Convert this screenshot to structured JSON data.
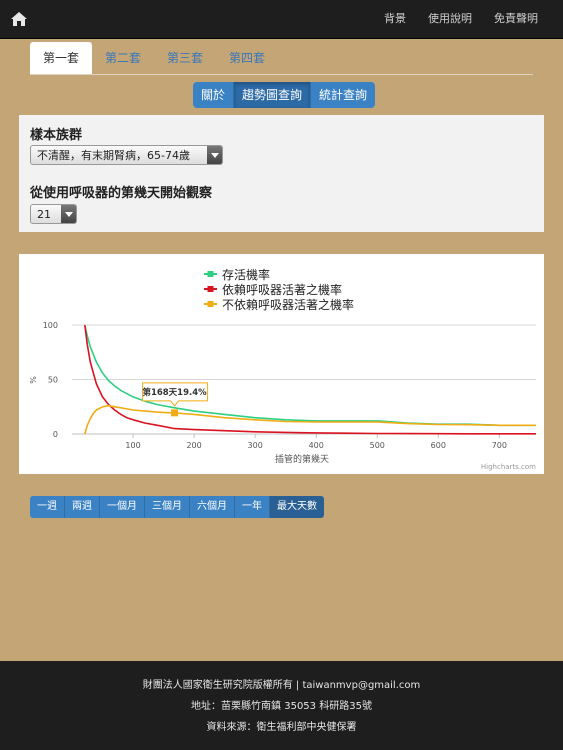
{
  "nav": {
    "items": [
      "背景",
      "使用說明",
      "免責聲明"
    ]
  },
  "tabs": [
    {
      "label": "第一套",
      "active": true
    },
    {
      "label": "第二套",
      "active": false
    },
    {
      "label": "第三套",
      "active": false
    },
    {
      "label": "第四套",
      "active": false
    }
  ],
  "modes": [
    {
      "label": "關於",
      "active": false
    },
    {
      "label": "趨勢圖查詢",
      "active": true
    },
    {
      "label": "統計查詢",
      "active": false
    }
  ],
  "form": {
    "population_label": "樣本族群",
    "population_value": "不清醒，有末期腎病，65-74歲",
    "start_day_label": "從使用呼吸器的第幾天開始觀察",
    "start_day_value": "21"
  },
  "chart_data": {
    "type": "line",
    "xlabel": "插管的第幾天",
    "ylabel": "%",
    "xlim": [
      0,
      760
    ],
    "ylim": [
      0,
      100
    ],
    "xticks": [
      100,
      200,
      300,
      400,
      500,
      600,
      700
    ],
    "yticks": [
      0,
      50,
      100
    ],
    "grid": true,
    "legend": "top-center",
    "credit": "Highcharts.com",
    "tooltip": {
      "x": 168,
      "y": 19.4,
      "text": "第168天19.4%"
    },
    "series": [
      {
        "name": "存活機率",
        "color": "#2ecf82",
        "x": [
          21,
          25,
          30,
          40,
          50,
          60,
          70,
          80,
          90,
          100,
          120,
          140,
          168,
          200,
          250,
          300,
          350,
          400,
          450,
          500,
          550,
          600,
          650,
          700,
          760
        ],
        "y": [
          100,
          90,
          80,
          66,
          56,
          49,
          44,
          40,
          37,
          34,
          30,
          27,
          24,
          21,
          18,
          15,
          13,
          12,
          12,
          12,
          10,
          9,
          9,
          8,
          8
        ]
      },
      {
        "name": "依賴呼吸器活著之機率",
        "color": "#d9131f",
        "x": [
          21,
          25,
          30,
          40,
          50,
          60,
          70,
          80,
          90,
          100,
          120,
          140,
          168,
          200,
          250,
          300,
          350,
          400,
          450,
          500,
          550,
          600,
          650,
          700,
          760
        ],
        "y": [
          100,
          82,
          66,
          46,
          34,
          27,
          22,
          18,
          15,
          13,
          10,
          8,
          5,
          4,
          3,
          2,
          1.5,
          1,
          0.7,
          0.5,
          0.4,
          0.3,
          0.2,
          0.2,
          0.2
        ]
      },
      {
        "name": "不依賴呼吸器活著之機率",
        "color": "#f0ac14",
        "x": [
          21,
          25,
          30,
          35,
          40,
          50,
          60,
          70,
          80,
          90,
          100,
          120,
          140,
          168,
          200,
          250,
          300,
          350,
          400,
          450,
          500,
          550,
          600,
          650,
          700,
          760
        ],
        "y": [
          0,
          8,
          14,
          19,
          22,
          25,
          26,
          25,
          24,
          23,
          22,
          21,
          20,
          19.4,
          18,
          15,
          13,
          11.5,
          11,
          11,
          11,
          9.5,
          8.7,
          8.5,
          8,
          8
        ]
      }
    ]
  },
  "periods": [
    {
      "label": "一週",
      "active": false
    },
    {
      "label": "兩週",
      "active": false
    },
    {
      "label": "一個月",
      "active": false
    },
    {
      "label": "三個月",
      "active": false
    },
    {
      "label": "六個月",
      "active": false
    },
    {
      "label": "一年",
      "active": false
    },
    {
      "label": "最大天數",
      "active": true
    }
  ],
  "footer": {
    "line1": "財團法人國家衛生研究院版權所有 | taiwanmvp@gmail.com",
    "line2": "地址：苗栗縣竹南鎮 35053 科研路35號",
    "line3": "資料來源：衛生福利部中央健保署"
  }
}
